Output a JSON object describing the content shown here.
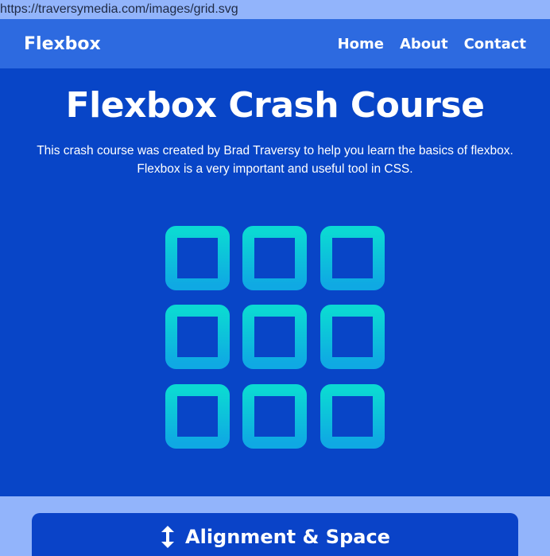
{
  "browser": {
    "url": "https://traversymedia.com/images/grid.svg"
  },
  "navbar": {
    "brand": "Flexbox",
    "links": [
      {
        "label": "Home"
      },
      {
        "label": "About"
      },
      {
        "label": "Contact"
      }
    ]
  },
  "hero": {
    "title": "Flexbox Crash Course",
    "subtitle": "This crash course was created by Brad Traversy to help you learn the basics of flexbox. Flexbox is a very important and useful tool in CSS.",
    "graphic_icon": "grid-icon"
  },
  "section": {
    "title": "Alignment & Space",
    "icon": "vertical-arrows-icon"
  },
  "colors": {
    "page_bg": "#92b4fb",
    "navbar_bg": "#2d6ae0",
    "hero_bg": "#0845c7",
    "grid_gradient_top": "#0bd9d3",
    "grid_gradient_bottom": "#0fa9e3"
  }
}
